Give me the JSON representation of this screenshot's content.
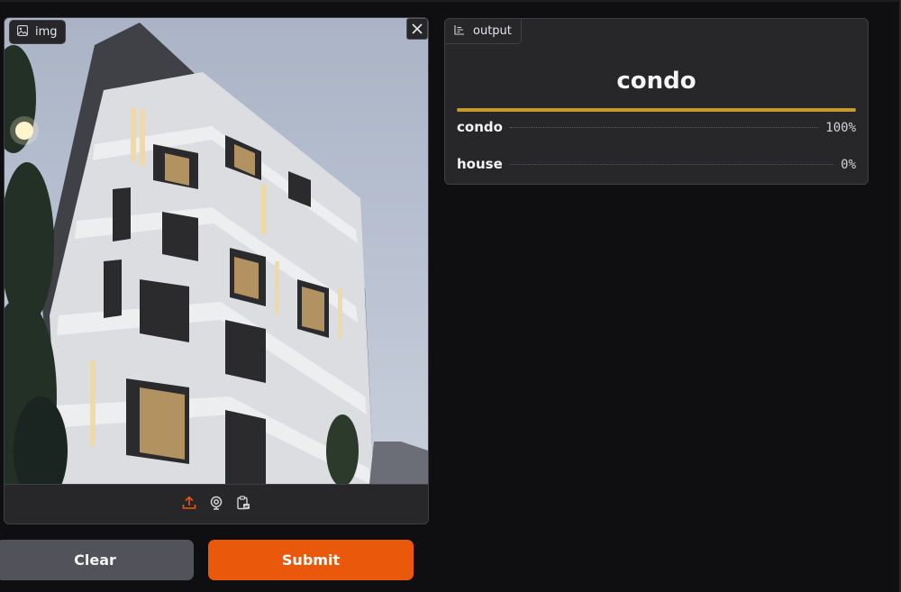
{
  "input": {
    "label": "img",
    "tools": [
      "upload-icon",
      "webcam-icon",
      "clipboard-icon"
    ],
    "accent": "#ea580c"
  },
  "buttons": {
    "clear": "Clear",
    "submit": "Submit"
  },
  "output": {
    "label": "output",
    "predicted": "condo",
    "confidences": [
      {
        "label": "condo",
        "value": "100%",
        "fraction": 1.0
      },
      {
        "label": "house",
        "value": "0%",
        "fraction": 0.0
      }
    ],
    "bar_color": "#c79a2e"
  }
}
